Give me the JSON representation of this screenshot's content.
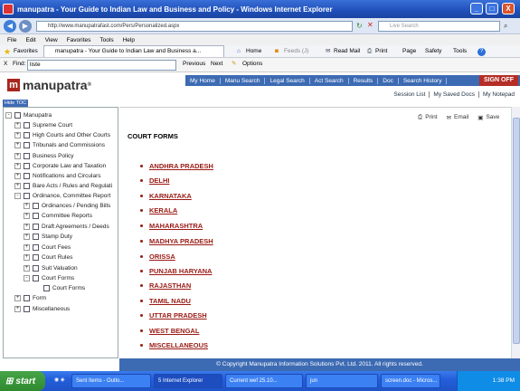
{
  "window": {
    "title": "manupatra - Your Guide to Indian Law and Business and Policy - Windows Internet Explorer",
    "minimize": "_",
    "maximize": "□",
    "close": "X"
  },
  "addressbar": {
    "url": "http://www.manupatrafast.com/Pers/Personalized.aspx",
    "search_placeholder": "Live Search"
  },
  "menu": [
    "File",
    "Edit",
    "View",
    "Favorites",
    "Tools",
    "Help"
  ],
  "favorites": {
    "label": "Favorites",
    "tab_title": "manupatra - Your Guide to Indian Law and Business a...",
    "commands": {
      "home": "Home",
      "feeds": "Feeds (J)",
      "read_mail": "Read Mail",
      "print": "Print",
      "page": "Page",
      "safety": "Safety",
      "tools": "Tools",
      "help": "?"
    }
  },
  "findbar": {
    "close": "X",
    "label": "Find:",
    "value": "liste",
    "previous": "Previous",
    "next": "Next",
    "options": "Options"
  },
  "site": {
    "logo_text": "manupatra",
    "logo_mark": "m",
    "logo_reg": "®",
    "nav": [
      "My Home",
      "Manu Search",
      "Legal Search",
      "Act Search",
      "Results",
      "Doc",
      "Search History"
    ],
    "signoff": "SIGN OFF",
    "subnav": [
      "Session List",
      "My Saved Docs",
      "My Notepad"
    ],
    "hide_toc": "Hide TOC"
  },
  "toc": {
    "root": "Manupatra",
    "items": [
      {
        "label": "Supreme Court",
        "expander": "+"
      },
      {
        "label": "High Courts and Other Courts",
        "expander": "+"
      },
      {
        "label": "Tribunals and Commissions",
        "expander": "+"
      },
      {
        "label": "Business Policy",
        "expander": "+"
      },
      {
        "label": "Corporate Law and Taxation",
        "expander": "+"
      },
      {
        "label": "Notifications and Circulars",
        "expander": "+"
      },
      {
        "label": "Bare Acts / Rules and Regulati",
        "expander": "+"
      },
      {
        "label": "Ordinance, Committee Report",
        "expander": "-"
      }
    ],
    "children": [
      {
        "label": "Ordinances / Pending Bills",
        "expander": "+"
      },
      {
        "label": "Committee Reports",
        "expander": "+"
      },
      {
        "label": "Draft Agreements / Deeds",
        "expander": "+"
      },
      {
        "label": "Stamp Duty",
        "expander": "+"
      },
      {
        "label": "Court Fees",
        "expander": "+"
      },
      {
        "label": "Court Rules",
        "expander": "+"
      },
      {
        "label": "Suit Valuation",
        "expander": "+"
      },
      {
        "label": "Court Forms",
        "expander": "-"
      }
    ],
    "grandchild": "Court Forms",
    "after": [
      {
        "label": "Form",
        "expander": "+"
      },
      {
        "label": "Miscellaneous",
        "expander": "+"
      }
    ]
  },
  "content": {
    "tools": {
      "print": "Print",
      "email": "Email",
      "save": "Save"
    },
    "title": "COURT FORMS",
    "states": [
      "ANDHRA PRADESH",
      "DELHI",
      "KARNATAKA",
      "KERALA",
      "MAHARASHTRA",
      "MADHYA PRADESH",
      "ORISSA",
      "PUNJAB HARYANA",
      "RAJASTHAN",
      "TAMIL NADU",
      "UTTAR PRADESH",
      "WEST BENGAL",
      "MISCELLANEOUS"
    ]
  },
  "footer": "© Copyright Manupatra Information Solutions Pvt. Ltd. 2011. All rights reserved.",
  "taskbar": {
    "start": "start",
    "tasks": [
      "Sent Items - Outlo...",
      "5 Internet Explorer",
      "Current wef 25.10...",
      "jun",
      "screen.doc - Micros...",
      ""
    ],
    "clock": "1:38 PM"
  }
}
